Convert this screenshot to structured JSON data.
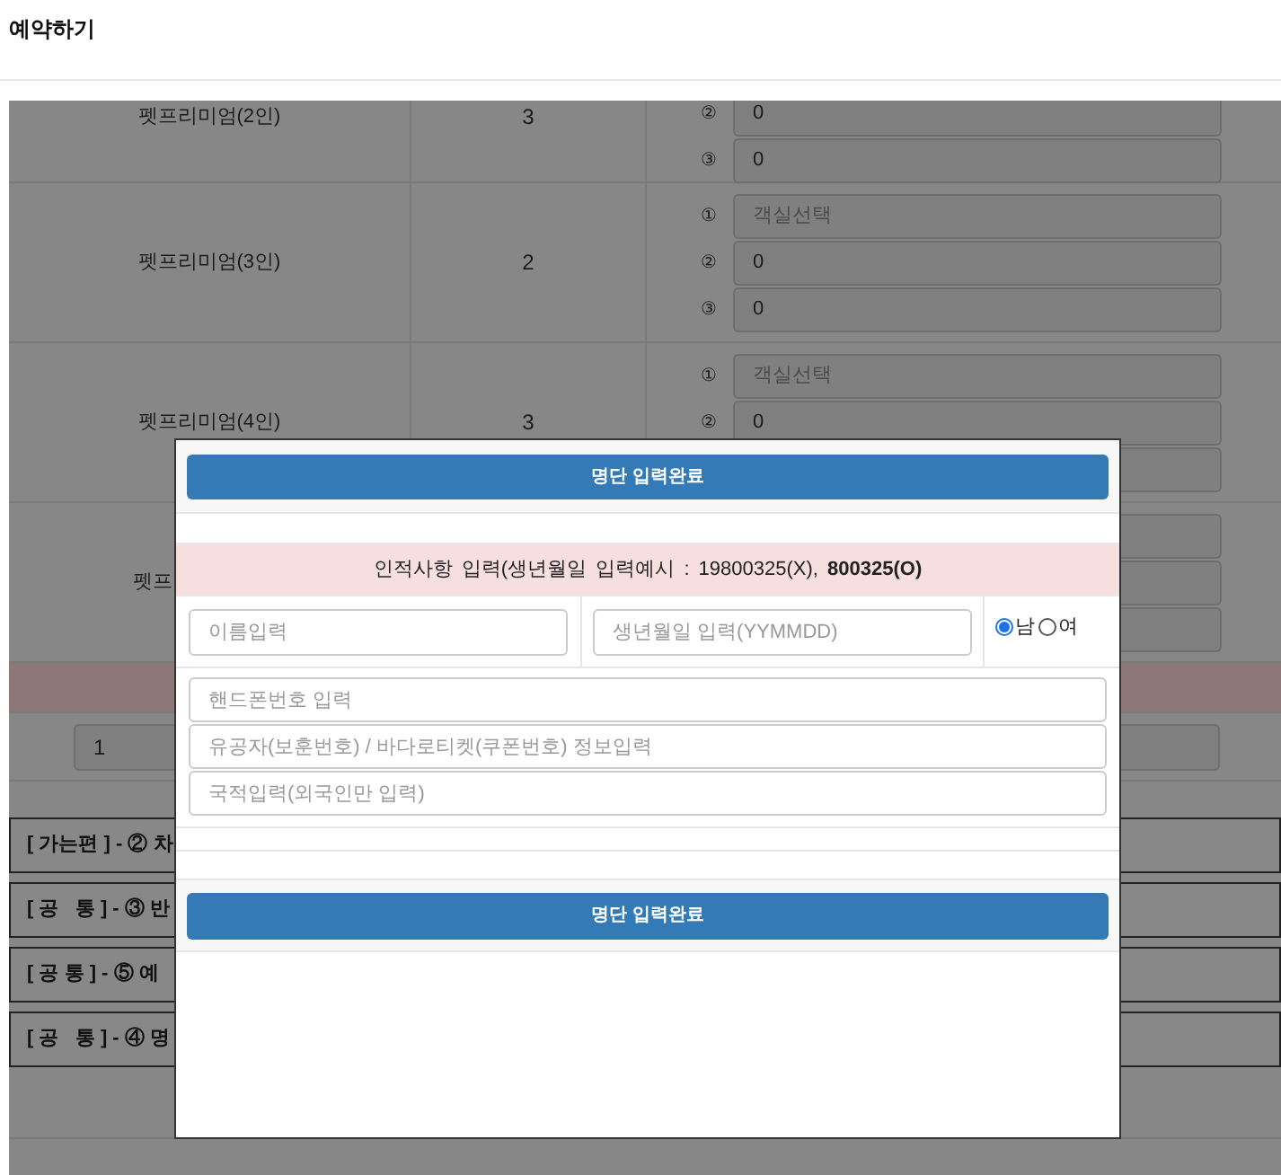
{
  "page_title": "예약하기",
  "room_table": {
    "rows": [
      {
        "kind": "top",
        "name": "펫프리미엄(2인)",
        "count": "3",
        "rooms": [
          {
            "kind": "field",
            "marker": "②",
            "value": "0"
          },
          {
            "kind": "field",
            "marker": "③",
            "value": "0"
          }
        ]
      },
      {
        "kind": "full",
        "name": "펫프리미엄(3인)",
        "count": "2",
        "rooms": [
          {
            "kind": "field",
            "marker": "①",
            "placeholder": "객실선택"
          },
          {
            "kind": "field",
            "marker": "②",
            "value": "0"
          },
          {
            "kind": "field",
            "marker": "③",
            "value": "0"
          }
        ]
      },
      {
        "kind": "full",
        "name": "펫프리미엄(4인)",
        "count": "3",
        "rooms": [
          {
            "kind": "field",
            "marker": "①",
            "placeholder": "객실선택"
          },
          {
            "kind": "field",
            "marker": "②",
            "value": "0"
          },
          {
            "kind": "covered"
          }
        ]
      },
      {
        "kind": "partial",
        "name": "펫프",
        "rooms": [
          {
            "kind": "covered"
          },
          {
            "kind": "covered"
          },
          {
            "kind": "covered"
          }
        ]
      }
    ]
  },
  "quantity_value": "1",
  "sections": [
    "[ 가는편 ] - ② 차",
    "[ 공   통 ] - ③ 반",
    "[ 공 통 ] - ⑤ 예",
    "[ 공   통 ] - ④ 명"
  ],
  "modal": {
    "top_button": "명단 입력완료",
    "notice": "인적사항 입력(생년월일 입력예시 : 19800325(X), **800325(O)**",
    "name_placeholder": "이름입력",
    "birth_placeholder": "생년월일 입력(YYMMDD)",
    "gender_options": [
      {
        "label": "남",
        "selected": true
      },
      {
        "label": "여",
        "selected": false
      }
    ],
    "phone_placeholder": "핸드폰번호 입력",
    "merit_placeholder": "유공자(보훈번호) / 바다로티켓(쿠폰번호) 정보입력",
    "nationality_placeholder": "국적입력(외국인만 입력)",
    "bottom_button": "명단 입력완료"
  }
}
